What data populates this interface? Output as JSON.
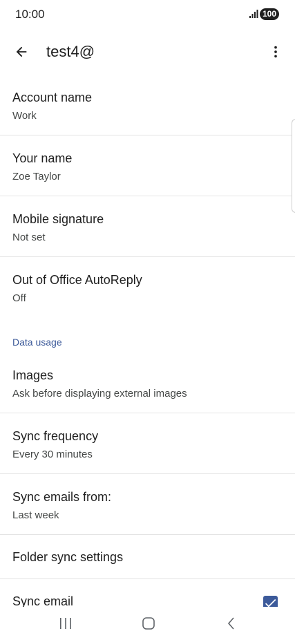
{
  "status_bar": {
    "time": "10:00",
    "battery": "100",
    "signal_icon": "signal-bars-icon"
  },
  "app_bar": {
    "title": "test4@",
    "back_icon": "arrow-back-icon",
    "menu_icon": "more-vert-icon"
  },
  "settings": {
    "account_name": {
      "title": "Account name",
      "summary": "Work"
    },
    "your_name": {
      "title": "Your name",
      "summary": "Zoe Taylor"
    },
    "mobile_signature": {
      "title": "Mobile signature",
      "summary": "Not set"
    },
    "out_of_office": {
      "title": "Out of Office AutoReply",
      "summary": "Off"
    },
    "data_usage_header": "Data usage",
    "images": {
      "title": "Images",
      "summary": "Ask before displaying external images"
    },
    "sync_frequency": {
      "title": "Sync frequency",
      "summary": "Every 30 minutes"
    },
    "sync_emails_from": {
      "title": "Sync emails from:",
      "summary": "Last week"
    },
    "folder_sync": {
      "title": "Folder sync settings"
    },
    "sync_email": {
      "title": "Sync email",
      "checked": true
    }
  },
  "colors": {
    "accent": "#3c5a9a",
    "text_primary": "#1f1f1f",
    "text_secondary": "#444746",
    "divider": "#e3e3e3"
  },
  "nav_bar": {
    "recents_icon": "recents-icon",
    "home_icon": "home-icon",
    "back_icon": "nav-back-icon"
  }
}
